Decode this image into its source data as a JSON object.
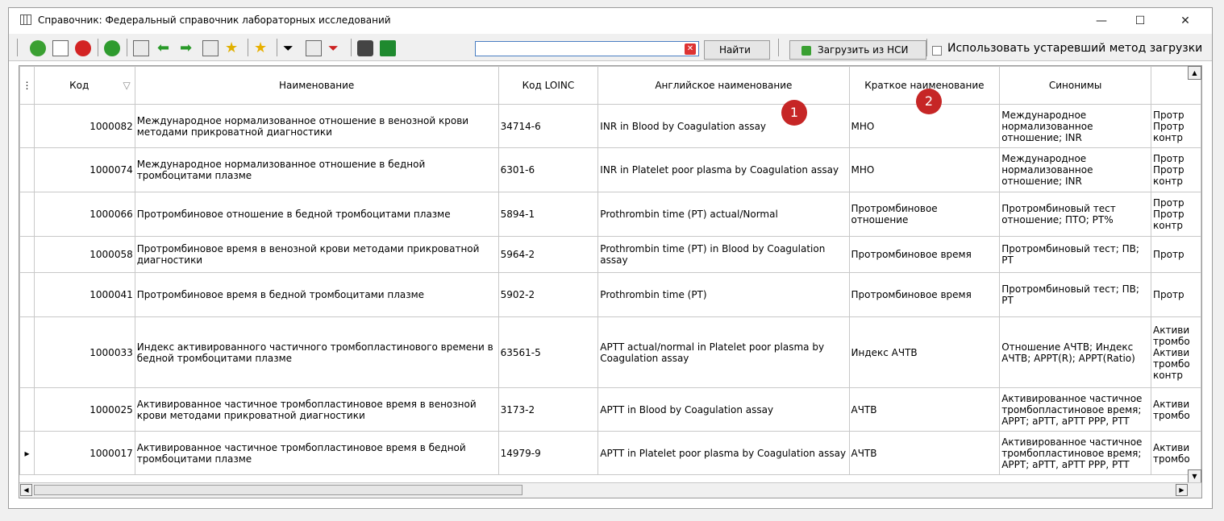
{
  "window": {
    "title": "Справочник: Федеральный справочник лабораторных исследований",
    "minimize": "—",
    "maximize": "☐",
    "close": "✕"
  },
  "toolbar": {
    "search_value": "",
    "clear_glyph": "✕",
    "find_label": "Найти",
    "load_nsi_label": "Загрузить из НСИ",
    "legacy_checkbox_label": "Использовать устаревший метод загрузки",
    "icons": [
      "add-icon",
      "edit-icon",
      "delete-icon",
      "refresh-icon",
      "copy-icon",
      "arrow-left-icon",
      "arrow-right-icon",
      "paste-icon",
      "add-star-icon",
      "favorite-icon",
      "filter-icon",
      "filter-edit-icon",
      "filter-clear-icon",
      "print-icon",
      "excel-icon"
    ]
  },
  "grid": {
    "columns": [
      "Код",
      "Наименование",
      "Код LOINC",
      "Английское наименование",
      "Краткое наименование",
      "Синонимы",
      ""
    ],
    "rows": [
      {
        "code": "1000082",
        "name": "Международное нормализованное отношение в венозной крови методами прикроватной диагностики",
        "loinc": "34714-6",
        "english": "INR in Blood by Coagulation assay",
        "short": "МНО",
        "synonyms": "Международное нормализованное отношение; INR",
        "extra": "Протр Протр контр"
      },
      {
        "code": "1000074",
        "name": "Международное нормализованное отношение в бедной тромбоцитами плазме",
        "loinc": "6301-6",
        "english": "INR in Platelet poor plasma by Coagulation assay",
        "short": "МНО",
        "synonyms": "Международное нормализованное отношение; INR",
        "extra": "Протр Протр контр"
      },
      {
        "code": "1000066",
        "name": "Протромбиновое отношение в бедной тромбоцитами плазме",
        "loinc": "5894-1",
        "english": "Prothrombin time (PT) actual/Normal",
        "short": "Протромбиновое отношение",
        "synonyms": "Протромбиновый тест отношение; ПТО; PT%",
        "extra": "Протр Протр контр"
      },
      {
        "code": "1000058",
        "name": "Протромбиновое время в венозной крови методами прикроватной диагностики",
        "loinc": "5964-2",
        "english": "Prothrombin time (PT) in Blood by Coagulation assay",
        "short": "Протромбиновое время",
        "synonyms": "Протромбиновый тест; ПВ; PT",
        "extra": "Протр"
      },
      {
        "code": "1000041",
        "name": "Протромбиновое время в бедной тромбоцитами плазме",
        "loinc": "5902-2",
        "english": "Prothrombin time (PT)",
        "short": "Протромбиновое время",
        "synonyms": "Протромбиновый тест; ПВ; PT",
        "extra": "Протр"
      },
      {
        "code": "1000033",
        "name": "Индекс активированного частичного тромбопластинового времени в бедной тромбоцитами плазме",
        "loinc": "63561-5",
        "english": "APTT actual/normal in Platelet poor plasma by Coagulation assay",
        "short": "Индекс АЧТВ",
        "synonyms": "Отношение АЧТВ; Индекс АЧТВ; APPT(R); APPT(Ratio)",
        "extra": "Активи тромбо Активи тромбо контр"
      },
      {
        "code": "1000025",
        "name": "Активированное частичное тромбопластиновое время в венозной крови методами прикроватной диагностики",
        "loinc": "3173-2",
        "english": "APTT in Blood by Coagulation assay",
        "short": "АЧТВ",
        "synonyms": "Активированное частичное тромбопластиновое время; APPT; aPTT, aPTT PPP, PTT",
        "extra": "Активи тромбо"
      },
      {
        "code": "1000017",
        "name": "Активированное частичное тромбопластиновое время в бедной тромбоцитами плазме",
        "loinc": "14979-9",
        "english": "APTT in Platelet poor plasma by Coagulation assay",
        "short": "АЧТВ",
        "synonyms": "Активированное частичное тромбопластиновое время; APPT; aPTT, aPTT PPP, PTT",
        "extra": "Активи тромбо"
      }
    ]
  },
  "badges": [
    "1",
    "2"
  ]
}
